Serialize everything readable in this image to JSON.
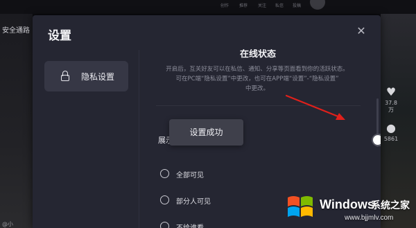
{
  "background": {
    "nav_items": [
      "创作",
      "推荐",
      "关注",
      "私信",
      "投稿"
    ],
    "left_title": "安全通路",
    "left_bottom": "@小",
    "side_stats": [
      {
        "icon": "heart-icon",
        "count": "37.8万"
      },
      {
        "icon": "comment-icon",
        "count": "5861"
      }
    ]
  },
  "dialog": {
    "title": "设置",
    "close_glyph": "✕",
    "sidebar": {
      "items": [
        {
          "label": "隐私设置",
          "icon": "lock-icon",
          "active": true
        }
      ]
    },
    "section": {
      "title": "在线状态",
      "description_lines": [
        "开启后，互关好友可以在私信、通知、分享等页面看到你的活跃状态。",
        "可在PC端“隐私设置”中更改，也可在APP端“设置”-“隐私设置”",
        "中更改。"
      ],
      "toggle_label": "展示",
      "toggle_on": false,
      "options": [
        {
          "label": "全部可见",
          "chevron": false
        },
        {
          "label": "部分人可见",
          "chevron": true
        },
        {
          "label": "不给谁看",
          "chevron": false
        }
      ]
    },
    "toast": "设置成功"
  },
  "annotation": {
    "arrow_color": "#e0201b"
  },
  "watermark": {
    "brand": "Windows",
    "site_cn": "系统之家",
    "url": "www.bjjmlv.com",
    "colors": {
      "red": "#f25022",
      "green": "#7fba00",
      "blue": "#00a4ef",
      "yellow": "#ffb900"
    }
  }
}
